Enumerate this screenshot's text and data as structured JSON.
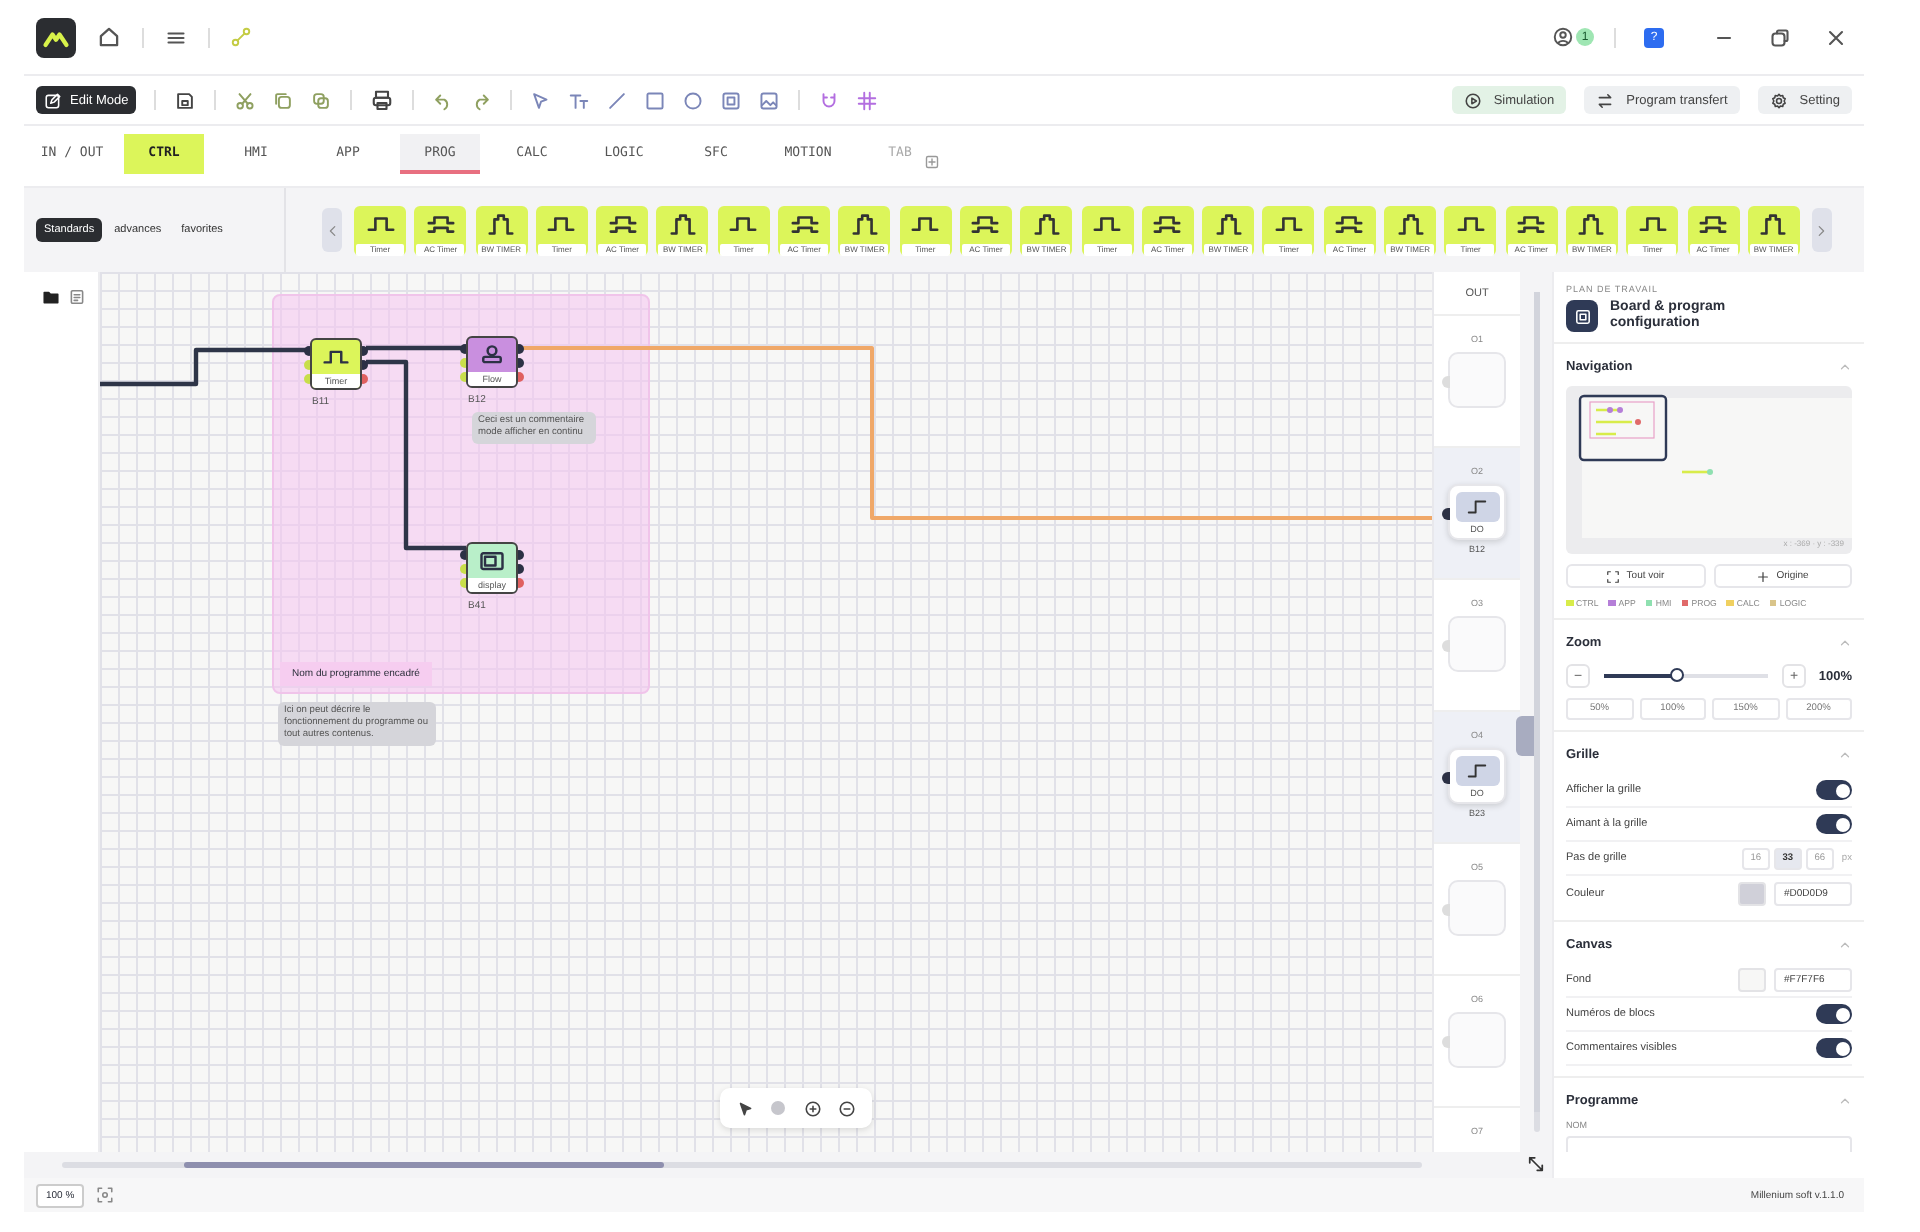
{
  "titlebar": {
    "notification_count": "1",
    "help_label": "?"
  },
  "toolbar": {
    "mode_button": "Edit Mode",
    "actions": [
      {
        "kind": "simulation",
        "label": "Simulation"
      },
      {
        "kind": "transfer",
        "label": "Program transfert"
      },
      {
        "kind": "settings",
        "label": "Setting"
      }
    ]
  },
  "tabs": [
    {
      "label": "IN / OUT",
      "selected": false,
      "hovered": false,
      "disabled": false
    },
    {
      "label": "CTRL",
      "selected": true,
      "hovered": false,
      "disabled": false
    },
    {
      "label": "HMI",
      "selected": false,
      "hovered": false,
      "disabled": false
    },
    {
      "label": "APP",
      "selected": false,
      "hovered": false,
      "disabled": false
    },
    {
      "label": "PROG",
      "selected": false,
      "hovered": true,
      "disabled": false
    },
    {
      "label": "CALC",
      "selected": false,
      "hovered": false,
      "disabled": false
    },
    {
      "label": "LOGIC",
      "selected": false,
      "hovered": false,
      "disabled": false
    },
    {
      "label": "SFC",
      "selected": false,
      "hovered": false,
      "disabled": false
    },
    {
      "label": "MOTION",
      "selected": false,
      "hovered": false,
      "disabled": false
    },
    {
      "label": "TAB",
      "selected": false,
      "hovered": false,
      "disabled": true
    }
  ],
  "palette": {
    "filters": [
      {
        "label": "Standards",
        "selected": true
      },
      {
        "label": "advances",
        "selected": false
      },
      {
        "label": "favorites",
        "selected": false
      }
    ],
    "blocks": [
      {
        "kind": "timer",
        "label": "Timer"
      },
      {
        "kind": "ac",
        "label": "AC Timer"
      },
      {
        "kind": "bw",
        "label": "BW TIMER"
      },
      {
        "kind": "timer",
        "label": "Timer"
      },
      {
        "kind": "ac",
        "label": "AC Timer"
      },
      {
        "kind": "bw",
        "label": "BW TIMER"
      },
      {
        "kind": "timer",
        "label": "Timer"
      },
      {
        "kind": "ac",
        "label": "AC Timer"
      },
      {
        "kind": "bw",
        "label": "BW TIMER"
      },
      {
        "kind": "timer",
        "label": "Timer"
      },
      {
        "kind": "ac",
        "label": "AC Timer"
      },
      {
        "kind": "bw",
        "label": "BW TIMER"
      },
      {
        "kind": "timer",
        "label": "Timer"
      },
      {
        "kind": "ac",
        "label": "AC Timer"
      },
      {
        "kind": "bw",
        "label": "BW TIMER"
      },
      {
        "kind": "timer",
        "label": "Timer"
      },
      {
        "kind": "ac",
        "label": "AC Timer"
      },
      {
        "kind": "bw",
        "label": "BW TIMER"
      },
      {
        "kind": "timer",
        "label": "Timer"
      },
      {
        "kind": "ac",
        "label": "AC Timer"
      },
      {
        "kind": "bw",
        "label": "BW TIMER"
      },
      {
        "kind": "timer",
        "label": "Timer"
      },
      {
        "kind": "ac",
        "label": "AC Timer"
      },
      {
        "kind": "bw",
        "label": "BW TIMER"
      }
    ]
  },
  "canvas": {
    "group": {
      "title": "Nom du programme encadré",
      "description": "Ici on peut décrire le fonctionnement du programme ou tout autres contenus."
    },
    "blocks": [
      {
        "kind": "timer",
        "label": "Timer",
        "number": "B11"
      },
      {
        "kind": "flow",
        "label": "Flow",
        "number": "B12",
        "comment": "Ceci est un commentaire mode afficher en continu"
      },
      {
        "kind": "display",
        "label": "display",
        "number": "B41"
      }
    ]
  },
  "outputs": {
    "title": "OUT",
    "slots": [
      {
        "label": "O1",
        "assigned": false
      },
      {
        "label": "O2",
        "assigned": true,
        "type": "DO",
        "block": "B12"
      },
      {
        "label": "O3",
        "assigned": false
      },
      {
        "label": "O4",
        "assigned": true,
        "type": "DO",
        "block": "B23"
      },
      {
        "label": "O5",
        "assigned": false
      },
      {
        "label": "O6",
        "assigned": false
      },
      {
        "label": "O7",
        "assigned": false
      }
    ]
  },
  "panel": {
    "eyebrow": "PLAN DE TRAVAIL",
    "title": "Board & program configuration",
    "navigation": {
      "title": "Navigation",
      "coords": "x : -369 · y : -339",
      "buttons": [
        "Tout voir",
        "Origine"
      ],
      "legend": [
        {
          "label": "CTRL",
          "color": "#d8ec4a"
        },
        {
          "label": "APP",
          "color": "#b57fd8"
        },
        {
          "label": "HMI",
          "color": "#8fe0b0"
        },
        {
          "label": "PROG",
          "color": "#e06a6a"
        },
        {
          "label": "CALC",
          "color": "#f0d060"
        },
        {
          "label": "LOGIC",
          "color": "#d9c48a"
        }
      ]
    },
    "zoom": {
      "title": "Zoom",
      "minus": "−",
      "plus": "+",
      "level": 0.44,
      "value": "100%",
      "presets": [
        "50%",
        "100%",
        "150%",
        "200%"
      ]
    },
    "grid": {
      "title": "Grille",
      "toggles": [
        {
          "label": "Afficher la grille",
          "on": true
        },
        {
          "label": "Aimant à la grille",
          "on": true
        }
      ],
      "step_label": "Pas de grille",
      "steps": [
        {
          "label": "16",
          "selected": false
        },
        {
          "label": "33",
          "selected": true
        },
        {
          "label": "66",
          "selected": false
        }
      ],
      "unit": "px",
      "color_label": "Couleur",
      "color_value": "#D0D0D9"
    },
    "canvas": {
      "title": "Canvas",
      "background_label": "Fond",
      "background_value": "#F7F7F6",
      "toggles": [
        {
          "label": "Numéros de blocs",
          "on": true
        },
        {
          "label": "Commentaires visibles",
          "on": true
        }
      ]
    },
    "program": {
      "title": "Programme",
      "name_label": "NOM"
    }
  },
  "status_bar": {
    "zoom": "100 %",
    "version": "Millenium soft v.1.1.0"
  }
}
